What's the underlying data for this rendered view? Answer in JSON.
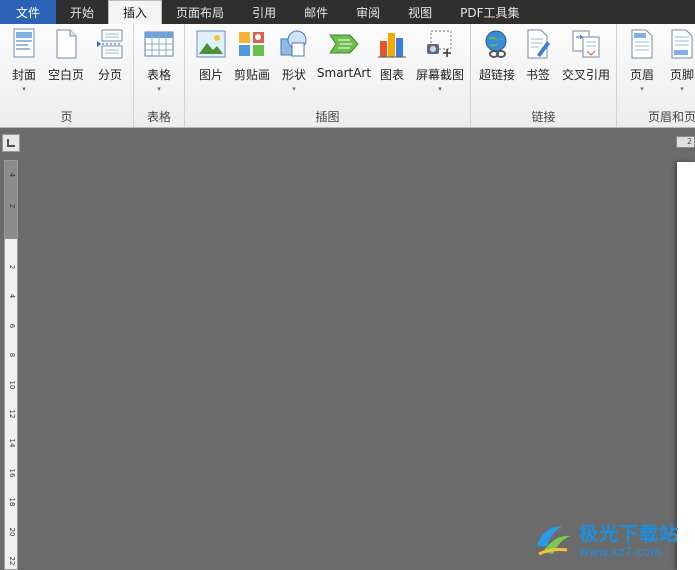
{
  "tabs": [
    {
      "key": "file",
      "label": "文件"
    },
    {
      "key": "home",
      "label": "开始"
    },
    {
      "key": "insert",
      "label": "插入"
    },
    {
      "key": "layout",
      "label": "页面布局"
    },
    {
      "key": "refs",
      "label": "引用"
    },
    {
      "key": "mail",
      "label": "邮件"
    },
    {
      "key": "review",
      "label": "审阅"
    },
    {
      "key": "view",
      "label": "视图"
    },
    {
      "key": "pdf",
      "label": "PDF工具集"
    }
  ],
  "active_tab": "插入",
  "groups": {
    "page": {
      "label": "页",
      "buttons": [
        {
          "label": "封面",
          "icon": "cover-page-icon",
          "dropdown": "▾"
        },
        {
          "label": "空白页",
          "icon": "blank-page-icon"
        },
        {
          "label": "分页",
          "icon": "page-break-icon"
        }
      ]
    },
    "table": {
      "label": "表格",
      "buttons": [
        {
          "label": "表格",
          "icon": "table-icon",
          "dropdown": "▾"
        }
      ]
    },
    "illustrations": {
      "label": "插图",
      "buttons": [
        {
          "label": "图片",
          "icon": "picture-icon"
        },
        {
          "label": "剪贴画",
          "icon": "clip-art-icon"
        },
        {
          "label": "形状",
          "icon": "shapes-icon",
          "dropdown": "▾"
        },
        {
          "label": "SmartArt",
          "icon": "smartart-icon"
        },
        {
          "label": "图表",
          "icon": "chart-icon"
        },
        {
          "label": "屏幕截图",
          "icon": "screenshot-icon",
          "dropdown": "▾"
        }
      ]
    },
    "links": {
      "label": "链接",
      "buttons": [
        {
          "label": "超链接",
          "icon": "hyperlink-icon"
        },
        {
          "label": "书签",
          "icon": "bookmark-icon"
        },
        {
          "label": "交叉引用",
          "icon": "cross-reference-icon"
        }
      ]
    },
    "header_footer": {
      "label": "页眉和页",
      "buttons": [
        {
          "label": "页眉",
          "icon": "header-icon",
          "dropdown": "▾"
        },
        {
          "label": "页脚",
          "icon": "footer-icon",
          "dropdown": "▾"
        }
      ]
    }
  },
  "ruler": {
    "vertical_labels": [
      "4",
      "2",
      "2",
      "4",
      "6",
      "8",
      "10",
      "12",
      "14",
      "16",
      "18",
      "20",
      "22"
    ],
    "top_stub": "2"
  },
  "watermark": {
    "name": "极光下载站",
    "url": "www.xz7.com"
  },
  "colors": {
    "tabbar": "#2f2f2f",
    "file_tab": "#2b62b5",
    "ribbon": "#f1f1f1",
    "canvas": "#6b6b6b",
    "accent": "#1e8fe0"
  }
}
